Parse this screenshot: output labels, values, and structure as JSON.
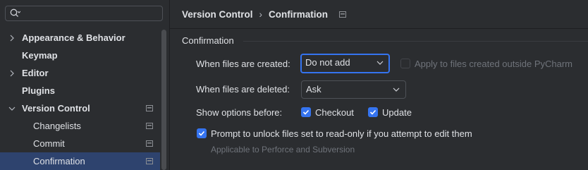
{
  "sidebar": {
    "search_placeholder": "",
    "items": [
      {
        "label": "Appearance & Behavior",
        "expanded": false
      },
      {
        "label": "Keymap"
      },
      {
        "label": "Editor",
        "expanded": false
      },
      {
        "label": "Plugins"
      },
      {
        "label": "Version Control",
        "expanded": true
      },
      {
        "label": "Changelists"
      },
      {
        "label": "Commit"
      },
      {
        "label": "Confirmation",
        "selected": true
      }
    ]
  },
  "breadcrumb": {
    "parent": "Version Control",
    "separator": "›",
    "current": "Confirmation"
  },
  "section": {
    "title": "Confirmation"
  },
  "form": {
    "created_label": "When files are created:",
    "created_value": "Do not add",
    "apply_outside_label": "Apply to files created outside PyCharm",
    "apply_outside_checked": false,
    "deleted_label": "When files are deleted:",
    "deleted_value": "Ask",
    "show_options_label": "Show options before:",
    "checkout_label": "Checkout",
    "checkout_checked": true,
    "update_label": "Update",
    "update_checked": true,
    "prompt_unlock_label": "Prompt to unlock files set to read-only if you attempt to edit them",
    "prompt_unlock_checked": true,
    "prompt_unlock_hint": "Applicable to Perforce and Subversion"
  },
  "colors": {
    "background": "#2b2d30",
    "accent": "#3574f0",
    "selection": "#2e436e",
    "text": "#dfe1e5",
    "disabled_text": "#6f737a"
  },
  "icons": {
    "search": "search-icon",
    "chevron_right": "chevron-right-icon",
    "chevron_down": "chevron-down-icon",
    "project": "project-scope-icon",
    "check": "checkmark-icon"
  }
}
